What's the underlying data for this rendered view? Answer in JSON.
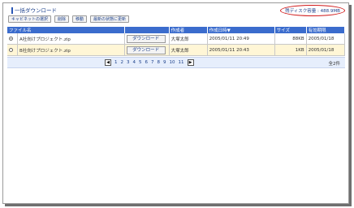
{
  "header": {
    "title": "一括ダウンロード",
    "disk_usage": "残ディスク容量 : 488.9MB"
  },
  "toolbar": {
    "buttons": [
      "キャビネットの選択",
      "削除",
      "移動",
      "最新の状態に更新"
    ]
  },
  "table": {
    "columns": [
      "ファイル名",
      "",
      "作成者",
      "作成日時▼",
      "サイズ",
      "有効期限"
    ],
    "rows": [
      {
        "selected": true,
        "file": "A社向けプロジェクト.zip",
        "download": "ダウンロード",
        "author": "大塚太郎",
        "created": "2005/01/11 20:49",
        "size": "88KB",
        "expires": "2005/01/18"
      },
      {
        "selected": false,
        "file": "B社向けプロジェクト.zip",
        "download": "ダウンロード",
        "author": "大塚太郎",
        "created": "2005/01/11 20:43",
        "size": "1KB",
        "expires": "2005/01/18"
      }
    ]
  },
  "pager": {
    "prev": "◀",
    "next": "▶",
    "pages": [
      "1",
      "2",
      "3",
      "4",
      "5",
      "6",
      "7",
      "8",
      "9",
      "10",
      "11"
    ],
    "total": "全2件"
  }
}
